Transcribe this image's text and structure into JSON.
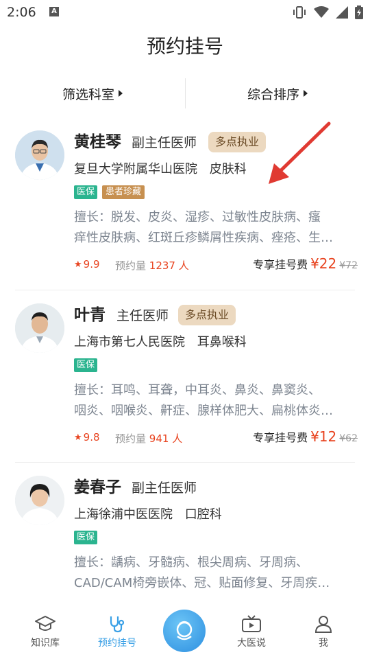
{
  "status_bar": {
    "time": "2:06",
    "badge_letter": "A"
  },
  "header": {
    "title": "预约挂号"
  },
  "filters": {
    "department": "筛选科室",
    "sort": "综合排序"
  },
  "doctors": [
    {
      "name": "黄桂琴",
      "title": "副主任医师",
      "multi_tag": "多点执业",
      "hospital": "复旦大学附属华山医院",
      "department": "皮肤科",
      "insurance_badge": "医保",
      "favorite_badge": "患者珍藏",
      "specialty_line1": "擅长：脱发、皮炎、湿疹、过敏性皮肤病、瘙",
      "specialty_line2": "痒性皮肤病、红斑丘疹鳞屑性疾病、痤疮、生…",
      "rating": "9.9",
      "appt_label": "预约量",
      "appt_count": "1237",
      "appt_unit": "人",
      "fee_label": "专享挂号费",
      "fee_price": "¥22",
      "fee_original": "¥72"
    },
    {
      "name": "叶青",
      "title": "主任医师",
      "multi_tag": "多点执业",
      "hospital": "上海市第七人民医院",
      "department": "耳鼻喉科",
      "insurance_badge": "医保",
      "specialty_line1": "擅长：耳鸣、耳聋，中耳炎、鼻炎、鼻窦炎、",
      "specialty_line2": "咽炎、咽喉炎、鼾症、腺样体肥大、扁桃体炎…",
      "rating": "9.8",
      "appt_label": "预约量",
      "appt_count": "941",
      "appt_unit": "人",
      "fee_label": "专享挂号费",
      "fee_price": "¥12",
      "fee_original": "¥62"
    },
    {
      "name": "姜春子",
      "title": "副主任医师",
      "hospital": "上海徐浦中医医院",
      "department": "口腔科",
      "insurance_badge": "医保",
      "specialty_line1": "擅长：龋病、牙髓病、根尖周病、牙周病、",
      "specialty_line2": "CAD/CAM椅旁嵌体、冠、贴面修复、牙周疾…"
    }
  ],
  "bottom_nav": {
    "knowledge": "知识库",
    "appointment": "预约挂号",
    "talk": "大医说",
    "me": "我"
  },
  "colors": {
    "accent_blue": "#3aa0e6",
    "price_red": "#e8431f",
    "insurance_green": "#2bb48f",
    "tag_tan": "#ecd9c0",
    "arrow_red": "#e03a32"
  }
}
